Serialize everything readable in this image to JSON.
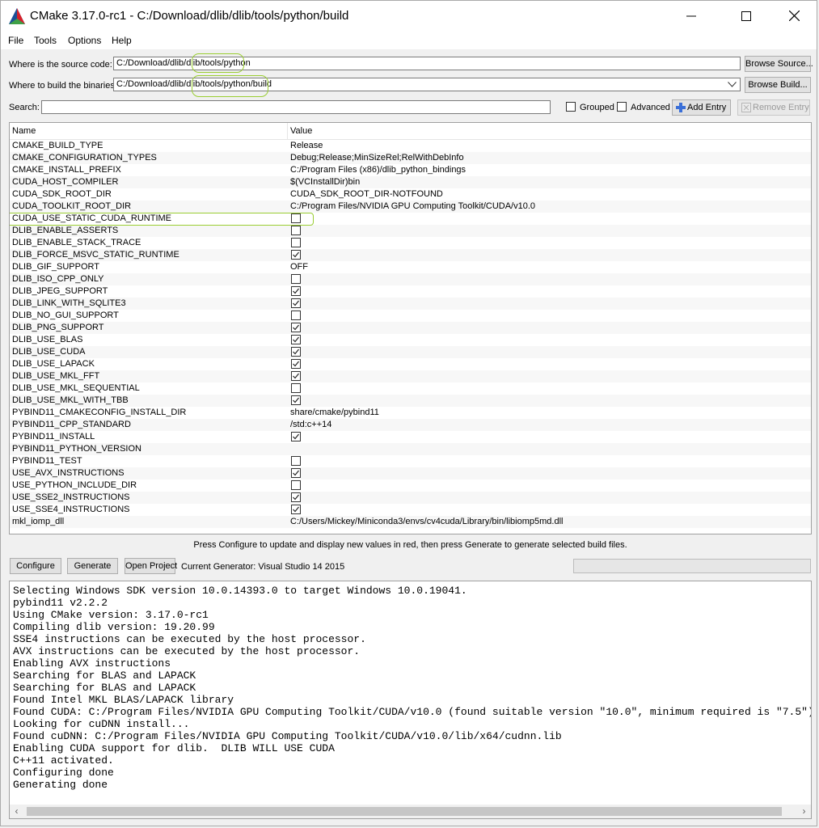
{
  "window": {
    "title": "CMake 3.17.0-rc1 - C:/Download/dlib/dlib/tools/python/build",
    "minimize": "—",
    "maximize": "☐",
    "close": "✕"
  },
  "menu": {
    "file": "File",
    "tools": "Tools",
    "options": "Options",
    "help": "Help"
  },
  "source": {
    "label": "Where is the source code:",
    "value": "C:/Download/dlib/dlib/tools/python",
    "browse": "Browse Source..."
  },
  "build": {
    "label": "Where to build the binaries:",
    "value": "C:/Download/dlib/dlib/tools/python/build",
    "browse": "Browse Build..."
  },
  "search": {
    "label": "Search:",
    "value": "",
    "grouped": "Grouped",
    "advanced": "Advanced",
    "add_entry": "Add Entry",
    "remove_entry": "Remove Entry"
  },
  "table": {
    "col_name": "Name",
    "col_value": "Value",
    "rows": [
      {
        "name": "CMAKE_BUILD_TYPE",
        "type": "text",
        "value": "Release"
      },
      {
        "name": "CMAKE_CONFIGURATION_TYPES",
        "type": "text",
        "value": "Debug;Release;MinSizeRel;RelWithDebInfo"
      },
      {
        "name": "CMAKE_INSTALL_PREFIX",
        "type": "text",
        "value": "C:/Program Files (x86)/dlib_python_bindings"
      },
      {
        "name": "CUDA_HOST_COMPILER",
        "type": "text",
        "value": "$(VCInstallDir)bin"
      },
      {
        "name": "CUDA_SDK_ROOT_DIR",
        "type": "text",
        "value": "CUDA_SDK_ROOT_DIR-NOTFOUND"
      },
      {
        "name": "CUDA_TOOLKIT_ROOT_DIR",
        "type": "text",
        "value": "C:/Program Files/NVIDIA GPU Computing Toolkit/CUDA/v10.0"
      },
      {
        "name": "CUDA_USE_STATIC_CUDA_RUNTIME",
        "type": "bool",
        "checked": false
      },
      {
        "name": "DLIB_ENABLE_ASSERTS",
        "type": "bool",
        "checked": false
      },
      {
        "name": "DLIB_ENABLE_STACK_TRACE",
        "type": "bool",
        "checked": false
      },
      {
        "name": "DLIB_FORCE_MSVC_STATIC_RUNTIME",
        "type": "bool",
        "checked": true
      },
      {
        "name": "DLIB_GIF_SUPPORT",
        "type": "text",
        "value": "OFF"
      },
      {
        "name": "DLIB_ISO_CPP_ONLY",
        "type": "bool",
        "checked": false
      },
      {
        "name": "DLIB_JPEG_SUPPORT",
        "type": "bool",
        "checked": true
      },
      {
        "name": "DLIB_LINK_WITH_SQLITE3",
        "type": "bool",
        "checked": true
      },
      {
        "name": "DLIB_NO_GUI_SUPPORT",
        "type": "bool",
        "checked": false
      },
      {
        "name": "DLIB_PNG_SUPPORT",
        "type": "bool",
        "checked": true
      },
      {
        "name": "DLIB_USE_BLAS",
        "type": "bool",
        "checked": true
      },
      {
        "name": "DLIB_USE_CUDA",
        "type": "bool",
        "checked": true
      },
      {
        "name": "DLIB_USE_LAPACK",
        "type": "bool",
        "checked": true
      },
      {
        "name": "DLIB_USE_MKL_FFT",
        "type": "bool",
        "checked": true
      },
      {
        "name": "DLIB_USE_MKL_SEQUENTIAL",
        "type": "bool",
        "checked": false
      },
      {
        "name": "DLIB_USE_MKL_WITH_TBB",
        "type": "bool",
        "checked": true
      },
      {
        "name": "PYBIND11_CMAKECONFIG_INSTALL_DIR",
        "type": "text",
        "value": "share/cmake/pybind11"
      },
      {
        "name": "PYBIND11_CPP_STANDARD",
        "type": "text",
        "value": "/std:c++14"
      },
      {
        "name": "PYBIND11_INSTALL",
        "type": "bool",
        "checked": true
      },
      {
        "name": "PYBIND11_PYTHON_VERSION",
        "type": "text",
        "value": ""
      },
      {
        "name": "PYBIND11_TEST",
        "type": "bool",
        "checked": false
      },
      {
        "name": "USE_AVX_INSTRUCTIONS",
        "type": "bool",
        "checked": true
      },
      {
        "name": "USE_PYTHON_INCLUDE_DIR",
        "type": "bool",
        "checked": false
      },
      {
        "name": "USE_SSE2_INSTRUCTIONS",
        "type": "bool",
        "checked": true
      },
      {
        "name": "USE_SSE4_INSTRUCTIONS",
        "type": "bool",
        "checked": true
      },
      {
        "name": "mkl_iomp_dll",
        "type": "text",
        "value": "C:/Users/Mickey/Miniconda3/envs/cv4cuda/Library/bin/libiomp5md.dll"
      }
    ]
  },
  "hint": "Press Configure to update and display new values in red, then press Generate to generate selected build files.",
  "actions": {
    "configure": "Configure",
    "generate": "Generate",
    "open_project": "Open Project",
    "generator": "Current Generator: Visual Studio 14 2015"
  },
  "output": [
    "Selecting Windows SDK version 10.0.14393.0 to target Windows 10.0.19041.",
    "pybind11 v2.2.2",
    "Using CMake version: 3.17.0-rc1",
    "Compiling dlib version: 19.20.99",
    "SSE4 instructions can be executed by the host processor.",
    "AVX instructions can be executed by the host processor.",
    "Enabling AVX instructions",
    "Searching for BLAS and LAPACK",
    "Searching for BLAS and LAPACK",
    "Found Intel MKL BLAS/LAPACK library",
    "Found CUDA: C:/Program Files/NVIDIA GPU Computing Toolkit/CUDA/v10.0 (found suitable version \"10.0\", minimum required is \"7.5\")",
    "Looking for cuDNN install...",
    "Found cuDNN: C:/Program Files/NVIDIA GPU Computing Toolkit/CUDA/v10.0/lib/x64/cudnn.lib",
    "Enabling CUDA support for dlib.  DLIB WILL USE CUDA",
    "C++11 activated.",
    "Configuring done",
    "Generating done"
  ],
  "colors": {
    "highlight": "#9acd32"
  }
}
